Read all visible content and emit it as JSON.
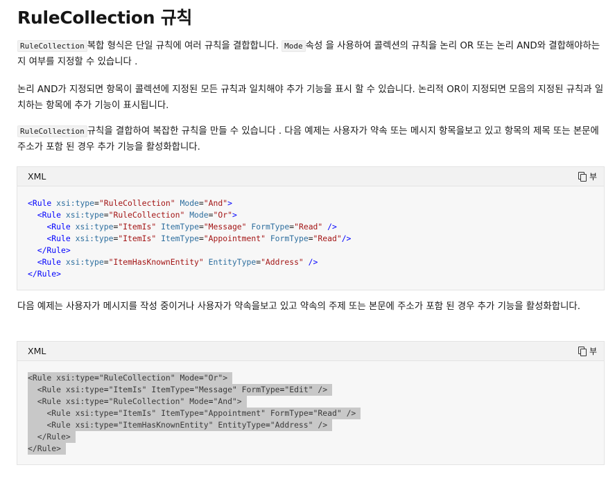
{
  "title": "RuleCollection 규칙",
  "para1": {
    "code1": "RuleCollection",
    "text1": "복합 형식은 단일 규칙에 여러 규칙을 결합합니다.",
    "code2": "Mode",
    "text2": "속성 을 사용하여 콜렉션의 규칙을 논리 OR 또는 논리 AND와 결합해야하는지 여부를 지정할 수 있습니다 ."
  },
  "para2": "논리 AND가 지정되면 항목이 콜렉션에 지정된 모든 규칙과 일치해야 추가 기능을 표시 할 수 있습니다. 논리적 OR이 지정되면 모음의 지정된 규칙과 일치하는 항목에 추가 기능이 표시됩니다.",
  "para3": {
    "code": "RuleCollection",
    "text": "규칙을 결합하여 복잡한 규칙을 만들 수 있습니다 . 다음 예제는 사용자가 약속 또는 메시지 항목을보고 있고 항목의 제목 또는 본문에 주소가 포함 된 경우 추가 기능을 활성화합니다."
  },
  "para4": "다음 예제는 사용자가 메시지를 작성 중이거나 사용자가 약속을보고 있고 약속의 주제 또는 본문에 주소가 포함 된 경우 추가 기능을 활성화합니다.",
  "code_block_1": {
    "language": "XML",
    "copy_label": "부",
    "lines": [
      "<Rule xsi:type=\"RuleCollection\" Mode=\"And\">",
      "  <Rule xsi:type=\"RuleCollection\" Mode=\"Or\">",
      "    <Rule xsi:type=\"ItemIs\" ItemType=\"Message\" FormType=\"Read\" />",
      "    <Rule xsi:type=\"ItemIs\" ItemType=\"Appointment\" FormType=\"Read\"/>",
      "  </Rule>",
      "  <Rule xsi:type=\"ItemHasKnownEntity\" EntityType=\"Address\" />",
      "</Rule>"
    ]
  },
  "code_block_2": {
    "language": "XML",
    "copy_label": "부",
    "highlighted": true,
    "lines": [
      "<Rule xsi:type=\"RuleCollection\" Mode=\"Or\">",
      "  <Rule xsi:type=\"ItemIs\" ItemType=\"Message\" FormType=\"Edit\" />",
      "  <Rule xsi:type=\"RuleCollection\" Mode=\"And\">",
      "    <Rule xsi:type=\"ItemIs\" ItemType=\"Appointment\" FormType=\"Read\" />",
      "    <Rule xsi:type=\"ItemHasKnownEntity\" EntityType=\"Address\" />",
      "  </Rule>",
      "</Rule>"
    ]
  },
  "colors": {
    "tag": "#0101fd",
    "attribute": "#2d6e9e",
    "value": "#a31515",
    "selection": "#c8c8c8"
  }
}
